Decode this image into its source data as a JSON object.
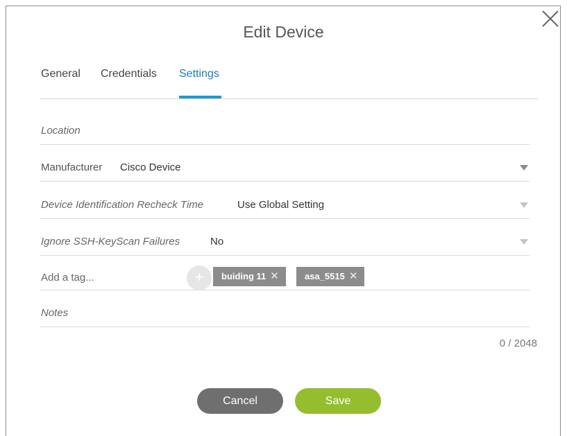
{
  "dialog": {
    "title": "Edit Device",
    "close_icon": "close-icon"
  },
  "tabs": [
    {
      "label": "General",
      "active": false
    },
    {
      "label": "Credentials",
      "active": false
    },
    {
      "label": "Settings",
      "active": true
    }
  ],
  "form": {
    "location": {
      "placeholder": "Location"
    },
    "manufacturer": {
      "label": "Manufacturer",
      "value": "Cisco Device"
    },
    "recheck_time": {
      "label": "Device Identification Recheck Time",
      "value": "Use Global Setting"
    },
    "ssh_keyscan": {
      "label": "Ignore SSH-KeyScan Failures",
      "value": "No"
    },
    "tags": {
      "placeholder": "Add a tag...",
      "add_icon": "plus-icon",
      "items": [
        {
          "label": "buiding 11"
        },
        {
          "label": "asa_5515"
        }
      ]
    },
    "notes": {
      "placeholder": "Notes",
      "counter": "0 / 2048"
    }
  },
  "footer": {
    "cancel_label": "Cancel",
    "save_label": "Save"
  },
  "colors": {
    "accent": "#1a9ad6",
    "save": "#95be2f",
    "cancel": "#6f6f6f",
    "tag": "#8c8c8c"
  }
}
